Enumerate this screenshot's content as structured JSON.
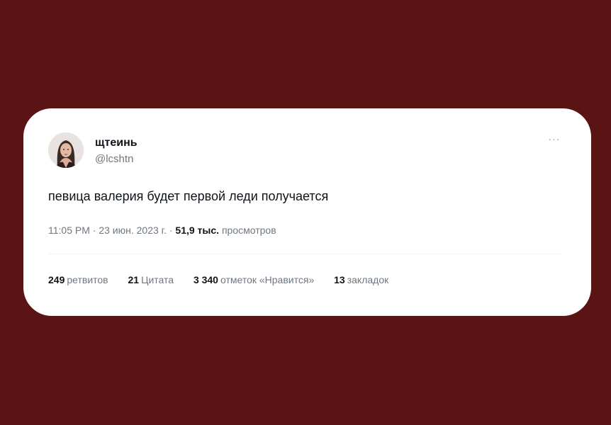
{
  "user": {
    "display_name": "щтеинь",
    "handle": "@lcshtn",
    "avatar": "avatar-photo"
  },
  "menu": {
    "icon": "more-horizontal-icon",
    "glyph": "···"
  },
  "tweet": {
    "text": "певица валерия будет первой леди получается"
  },
  "meta": {
    "time": "11:05 PM",
    "separator1": " · ",
    "date": "23 июн. 2023 г.",
    "separator2": " · ",
    "views_count": "51,9 тыс.",
    "views_label": "просмотров"
  },
  "stats": {
    "retweets": {
      "count": "249",
      "label": "ретвитов"
    },
    "quotes": {
      "count": "21",
      "label": "Цитата"
    },
    "likes": {
      "count": "3 340",
      "label": "отметок «Нравится»"
    },
    "bookmarks": {
      "count": "13",
      "label": "закладок"
    }
  },
  "colors": {
    "background": "#5b1414",
    "card": "#ffffff",
    "text_primary": "#0f1419",
    "text_secondary": "#6e7781"
  }
}
